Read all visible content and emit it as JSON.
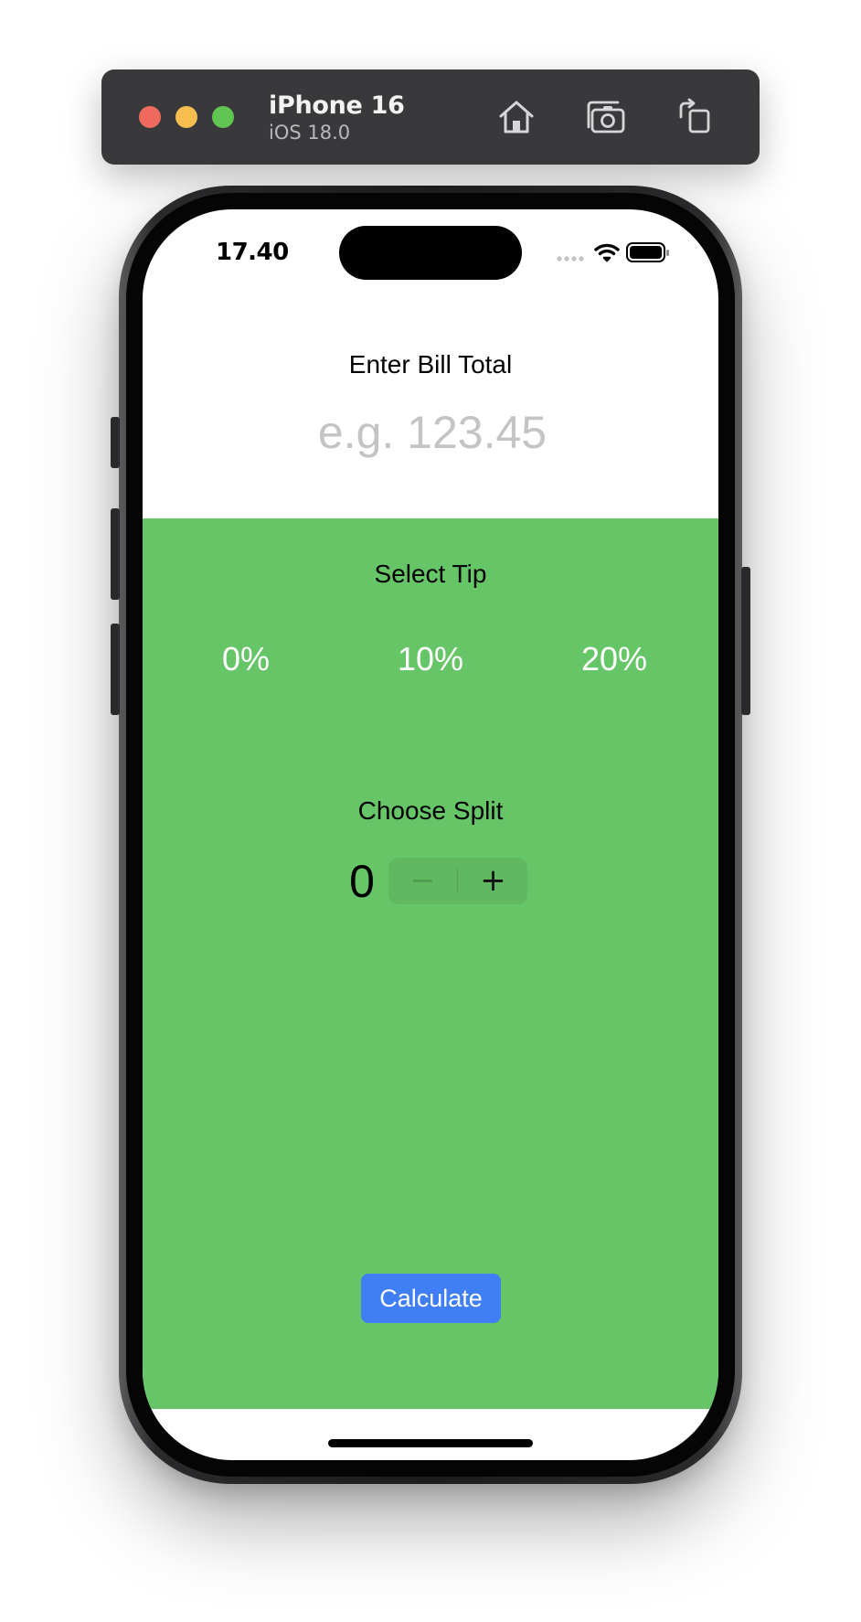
{
  "simulator": {
    "device_name": "iPhone 16",
    "os_version": "iOS 18.0",
    "icons": [
      "home-icon",
      "screenshot-icon",
      "rotate-icon"
    ]
  },
  "status_bar": {
    "time": "17.40",
    "icons": [
      "signal-icon",
      "wifi-icon",
      "battery-icon"
    ]
  },
  "bill": {
    "label": "Enter Bill Total",
    "value": "",
    "placeholder": "e.g. 123.45"
  },
  "tip": {
    "label": "Select Tip",
    "options": [
      "0%",
      "10%",
      "20%"
    ]
  },
  "split": {
    "label": "Choose Split",
    "value": "0",
    "minus": "−",
    "plus": "+"
  },
  "calculate_label": "Calculate",
  "colors": {
    "panel_green": "#66c566",
    "button_blue": "#3f7ef5",
    "toolbar_dark": "#39393b"
  }
}
